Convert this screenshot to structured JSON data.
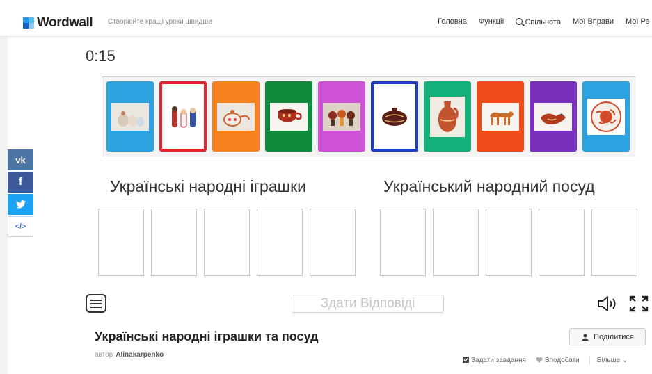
{
  "header": {
    "logo": "Wordwall",
    "tagline": "Створюйте кращі уроки швидше",
    "nav": [
      "Головна",
      "Функції",
      "Спільнота",
      "Мої Вправи",
      "Мої Ре"
    ]
  },
  "share_sidebar": {
    "vk": "vk",
    "fb": "f",
    "tw": "🐦",
    "embed": "</>"
  },
  "game": {
    "timer": "0:15",
    "cards": [
      {
        "bg": "#2ba3e0",
        "border": "#2ba3e0"
      },
      {
        "bg": "#ffffff",
        "border": "#e2242f"
      },
      {
        "bg": "#f5821f",
        "border": "#f5821f"
      },
      {
        "bg": "#0f8a3c",
        "border": "#0f8a3c"
      },
      {
        "bg": "#cf52d6",
        "border": "#cf52d6"
      },
      {
        "bg": "#ffffff",
        "border": "#1e3fc4"
      },
      {
        "bg": "#16b07b",
        "border": "#16b07b"
      },
      {
        "bg": "#ee4a1a",
        "border": "#ee4a1a"
      },
      {
        "bg": "#7a2fbd",
        "border": "#7a2fbd"
      },
      {
        "bg": "#2ba3e0",
        "border": "#2ba3e0"
      }
    ],
    "categories": [
      "Українські народні іграшки",
      "Український народний посуд"
    ],
    "submit_label": "Здати Відповіді"
  },
  "activity": {
    "title": "Українські народні іграшки та посуд",
    "author_prefix": "автор",
    "author": "Alinakarpenko",
    "share_label": "Поділитися",
    "actions": [
      "Задати завдання",
      "Вподобати",
      "Більше"
    ]
  }
}
